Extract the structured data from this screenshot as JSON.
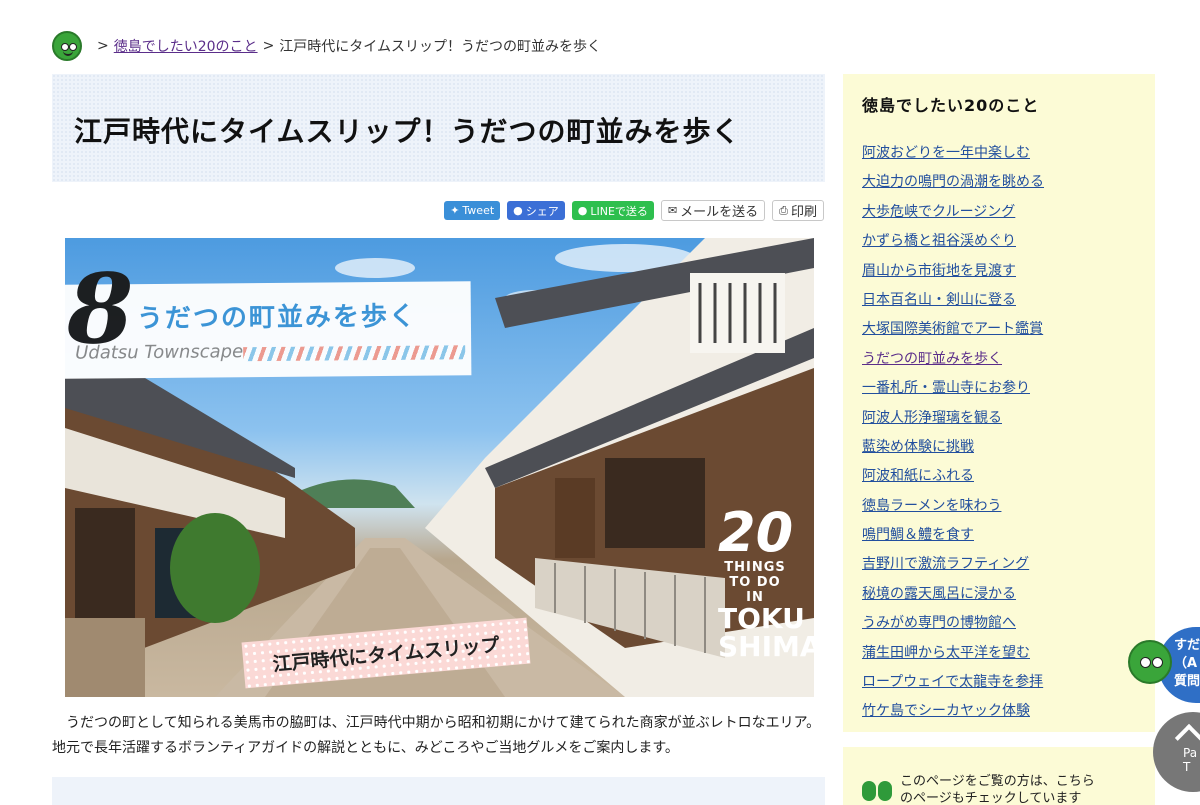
{
  "breadcrumb": {
    "sep1": ">",
    "parent": "徳島でしたい20のこと",
    "sep2": ">",
    "current": "江戸時代にタイムスリップ！うだつの町並みを歩く"
  },
  "page": {
    "title": "江戸時代にタイムスリップ！うだつの町並みを歩く"
  },
  "share": {
    "tweet": "Tweet",
    "facebook": "シェア",
    "line": "LINEで送る",
    "mail": "メールを送る",
    "print": "印刷"
  },
  "hero": {
    "number": "8",
    "title": "うだつの町並みを歩く",
    "subtitle": "Udatsu Townscape",
    "tag": "江戸時代にタイムスリップ",
    "badge_big": "20",
    "badge_line1": "THINGS",
    "badge_line2": "TO DO IN",
    "badge_line3": "TOKU",
    "badge_line4": "SHIMA"
  },
  "lead": "うだつの町として知られる美馬市の脇町は、江戸時代中期から昭和初期にかけて建てられた商家が並ぶレトロなエリア。地元で長年活躍するボランティアガイドの解説とともに、みどころやご当地グルメをご案内します。",
  "sidebar": {
    "heading": "徳島でしたい20のこと",
    "items": [
      {
        "label": "阿波おどりを一年中楽しむ"
      },
      {
        "label": "大迫力の鳴門の渦潮を眺める"
      },
      {
        "label": "大歩危峡でクルージング"
      },
      {
        "label": "かずら橋と祖谷渓めぐり"
      },
      {
        "label": "眉山から市街地を見渡す"
      },
      {
        "label": "日本百名山・剣山に登る"
      },
      {
        "label": "大塚国際美術館でアート鑑賞"
      },
      {
        "label": "うだつの町並みを歩く"
      },
      {
        "label": "一番札所・霊山寺にお参り"
      },
      {
        "label": "阿波人形浄瑠璃を観る"
      },
      {
        "label": "藍染め体験に挑戦"
      },
      {
        "label": "阿波和紙にふれる"
      },
      {
        "label": "徳島ラーメンを味わう"
      },
      {
        "label": "鳴門鯛＆鱧を食す"
      },
      {
        "label": "吉野川で激流ラフティング"
      },
      {
        "label": "秘境の露天風呂に浸かる"
      },
      {
        "label": "うみがめ専門の博物館へ"
      },
      {
        "label": "蒲生田岬から太平洋を望む"
      },
      {
        "label": "ロープウェイで太龍寺を参拝"
      },
      {
        "label": "竹ケ島でシーカヤック体験"
      }
    ],
    "related_line1": "このページをご覧の方は、こちら",
    "related_line2": "のページもチェックしています"
  },
  "floating": {
    "question_line1": "すだ",
    "question_line2": "（A",
    "question_line3": "質問",
    "pagetop_line1": "Pa",
    "pagetop_line2": "T"
  }
}
